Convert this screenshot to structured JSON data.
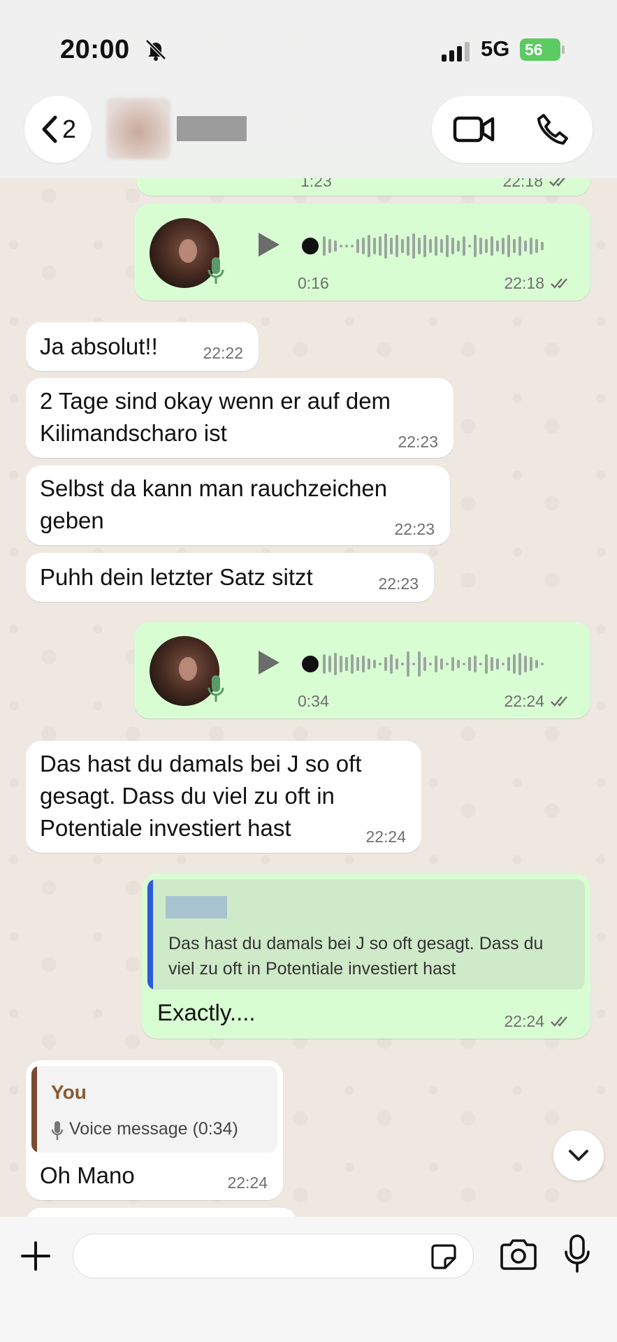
{
  "status_bar": {
    "time": "20:00",
    "network": "5G",
    "battery": "56"
  },
  "header": {
    "back_count": "2"
  },
  "messages": {
    "partial_voice": {
      "duration": "1:23",
      "time": "22:18"
    },
    "voice1": {
      "duration": "0:16",
      "time": "22:18"
    },
    "m1": {
      "text": "Ja absolut!!",
      "time": "22:22"
    },
    "m2": {
      "text": "2 Tage sind okay wenn er auf dem Kilimandscharo ist",
      "time": "22:23"
    },
    "m3": {
      "text": "Selbst da kann man rauchzeichen geben",
      "time": "22:23"
    },
    "m4": {
      "text": "Puhh dein letzter Satz sitzt",
      "time": "22:23"
    },
    "voice2": {
      "duration": "0:34",
      "time": "22:24"
    },
    "m5": {
      "text": "Das hast du damals bei J so oft gesagt. Dass du viel zu oft in Potentiale investiert hast",
      "time": "22:24"
    },
    "reply1": {
      "quoted_text": "Das hast du damals bei J so oft gesagt. Dass du viel zu oft in Potentiale investiert hast",
      "text": "Exactly....",
      "time": "22:24"
    },
    "reply2": {
      "quoted_author": "You",
      "quoted_text": "Voice message (0:34)",
      "text": "Oh Mano",
      "time": "22:24"
    }
  },
  "composer": {
    "value": ""
  },
  "colors": {
    "outgoing_bubble": "#d9fdd3",
    "incoming_bubble": "#ffffff",
    "quote_bar_outgoing": "#2b5bd7",
    "quote_bar_incoming": "#7a4a32",
    "quote_author": "#8a5a34"
  },
  "icons": {
    "back": "chevron-left-icon",
    "video": "video-camera-icon",
    "phone": "phone-icon",
    "scroll": "chevron-down-icon",
    "plus": "plus-icon",
    "sticker": "sticker-icon",
    "camera": "camera-icon",
    "mic": "microphone-icon"
  }
}
